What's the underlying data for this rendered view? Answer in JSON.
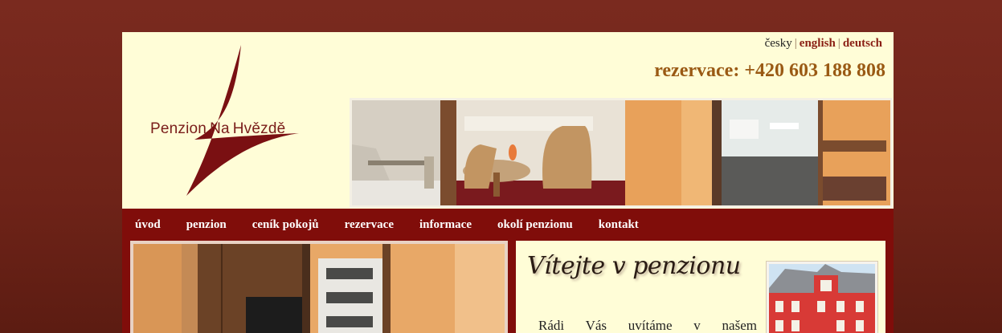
{
  "logo": {
    "word1": "Penzion",
    "word2": "Na",
    "word3": "Hvězdě"
  },
  "languages": {
    "cs": "česky",
    "en": "english",
    "de": "deutsch"
  },
  "reservation_phone": "rezervace: +420 603 188 808",
  "nav": [
    "úvod",
    "penzion",
    "ceník pokojů",
    "rezervace",
    "informace",
    "okolí penzionu",
    "kontakt"
  ],
  "welcome": {
    "title": "Vítejte v penzionu",
    "text": "Rádi Vás uvítáme v našem"
  },
  "colors": {
    "brand": "#800d0a",
    "cream": "#fffdd7",
    "phone": "#9a5a14"
  }
}
